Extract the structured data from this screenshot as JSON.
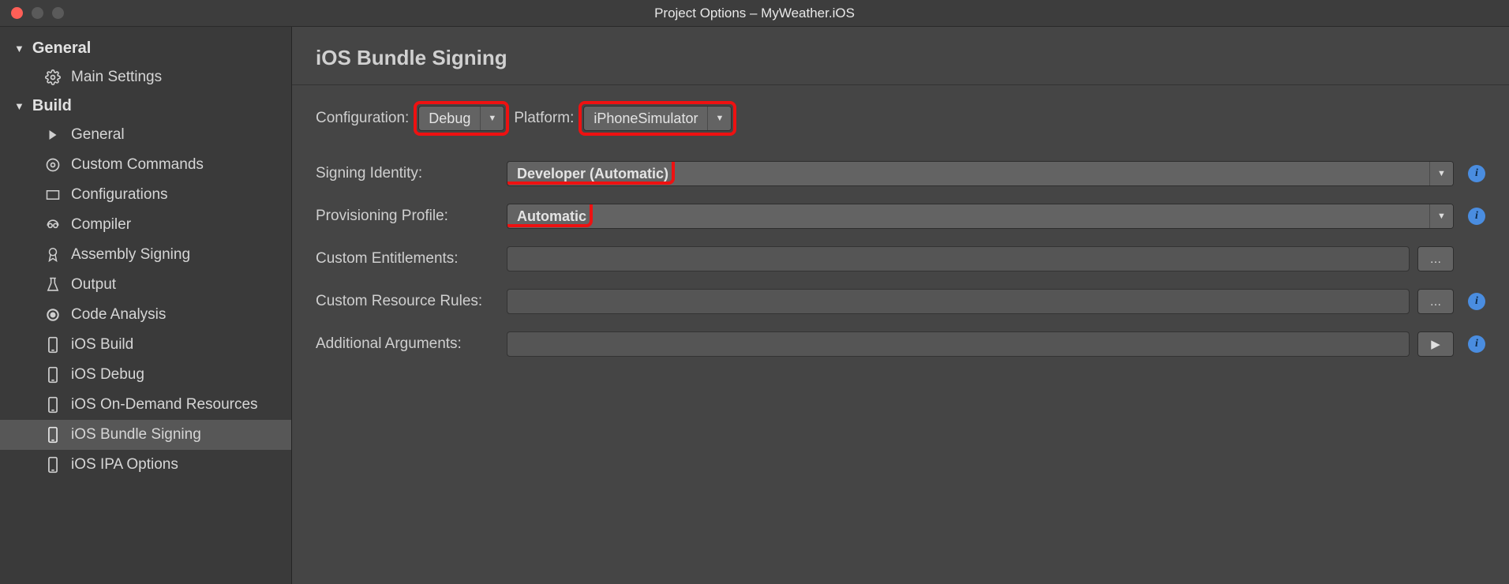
{
  "window": {
    "title": "Project Options – MyWeather.iOS"
  },
  "sidebar": {
    "sections": [
      {
        "label": "General",
        "items": [
          {
            "label": "Main Settings",
            "icon": "gear"
          }
        ]
      },
      {
        "label": "Build",
        "items": [
          {
            "label": "General",
            "icon": "play"
          },
          {
            "label": "Custom Commands",
            "icon": "gear"
          },
          {
            "label": "Configurations",
            "icon": "rect"
          },
          {
            "label": "Compiler",
            "icon": "robot"
          },
          {
            "label": "Assembly Signing",
            "icon": "ribbon"
          },
          {
            "label": "Output",
            "icon": "flask"
          },
          {
            "label": "Code Analysis",
            "icon": "target"
          },
          {
            "label": "iOS Build",
            "icon": "phone"
          },
          {
            "label": "iOS Debug",
            "icon": "phone"
          },
          {
            "label": "iOS On-Demand Resources",
            "icon": "phone"
          },
          {
            "label": "iOS Bundle Signing",
            "icon": "phone"
          },
          {
            "label": "iOS IPA Options",
            "icon": "phone"
          }
        ]
      }
    ]
  },
  "page": {
    "title": "iOS Bundle Signing",
    "config_label": "Configuration:",
    "config_value": "Debug",
    "platform_label": "Platform:",
    "platform_value": "iPhoneSimulator",
    "signing_identity_label": "Signing Identity:",
    "signing_identity_value": "Developer (Automatic)",
    "provisioning_label": "Provisioning Profile:",
    "provisioning_value": "Automatic",
    "custom_entitlements_label": "Custom Entitlements:",
    "custom_resource_rules_label": "Custom Resource Rules:",
    "additional_arguments_label": "Additional Arguments:",
    "browse": "…",
    "run": "▶"
  }
}
